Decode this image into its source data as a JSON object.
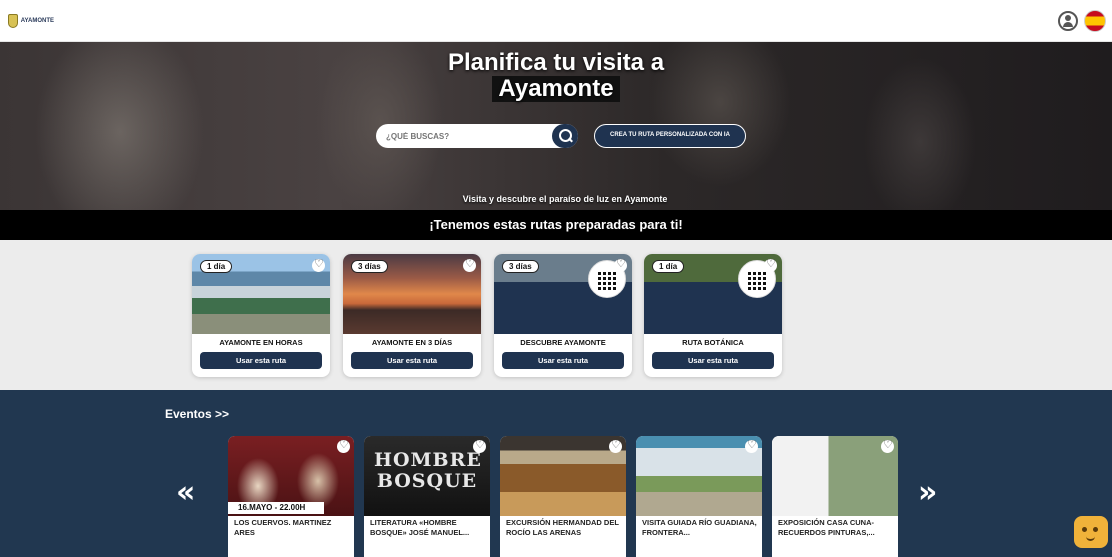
{
  "header": {
    "logo_text": "AYAMONTE",
    "user_icon": "user-circle-icon",
    "language_icon": "spain-flag-icon"
  },
  "hero": {
    "title_line1": "Planifica tu visita a",
    "title_line2": "Ayamonte",
    "search_placeholder": "¿QUÉ BUSCAS?",
    "search_icon": "search-icon",
    "ai_button": "CREA TU RUTA PERSONALIZADA CON IA",
    "subtitle": "Visita y descubre el paraíso de luz en Ayamonte"
  },
  "routes_banner": "¡Tenemos estas rutas preparadas para ti!",
  "routes": [
    {
      "days": "1 día",
      "title": "AYAMONTE EN HORAS",
      "button": "Usar esta ruta"
    },
    {
      "days": "3 días",
      "title": "AYAMONTE EN 3 DÍAS",
      "button": "Usar esta ruta"
    },
    {
      "days": "3 días",
      "title": "DESCUBRE AYAMONTE",
      "button": "Usar esta ruta"
    },
    {
      "days": "1 día",
      "title": "RUTA BOTÁNICA",
      "button": "Usar esta ruta"
    }
  ],
  "events": {
    "heading": "Eventos >>",
    "prev_label": "«",
    "next_label": "»",
    "items": [
      {
        "title": "LOS CUERVOS. MARTINEZ ARES",
        "date": "16.MAYO - 22.00H"
      },
      {
        "title": "LITERATURA «HOMBRE BOSQUE» JOSÉ MANUEL...",
        "poster": "HOMBRE BOSQUE"
      },
      {
        "title": "EXCURSIÓN HERMANDAD DEL ROCÍO LAS ARENAS"
      },
      {
        "title": "VISITA GUIADA RÍO GUADIANA, FRONTERA..."
      },
      {
        "title": "EXPOSICIÓN CASA CUNA-RECUERDOS PINTURAS,..."
      }
    ]
  },
  "chat": {
    "icon": "chat-bot-icon"
  }
}
